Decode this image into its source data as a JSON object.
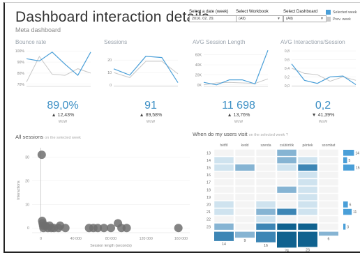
{
  "header": {
    "title": "Dashboard interaction details",
    "subtitle": "Meta dashboard"
  },
  "filters": {
    "date": {
      "label": "Select a date (week)",
      "value": "2016. 02. 29."
    },
    "workbook": {
      "label": "Select Workbook",
      "value": "(All)"
    },
    "dashboard": {
      "label": "Select Dashboard",
      "value": "(All)"
    }
  },
  "legend": [
    {
      "label": "Selected week",
      "color": "#4a9fd8"
    },
    {
      "label": "Prev. week",
      "color": "#c8c8c8"
    }
  ],
  "sparklines": [
    {
      "title": "Bounce rate",
      "yticks": [
        "100%",
        "90%",
        "80%",
        "70%"
      ],
      "ylim": [
        68,
        102
      ],
      "series": [
        {
          "name": "Selected week",
          "values": [
            93,
            91,
            99,
            88,
            78,
            99
          ]
        },
        {
          "name": "Prev. week",
          "values": [
            72,
            95,
            79,
            78,
            84,
            80
          ]
        }
      ]
    },
    {
      "title": "Sessions",
      "yticks": [
        "20",
        "10",
        "0"
      ],
      "ylim": [
        -1,
        29
      ],
      "series": [
        {
          "name": "Selected week",
          "values": [
            13,
            8,
            23,
            22,
            2
          ]
        },
        {
          "name": "Prev. week",
          "values": [
            10,
            6,
            19,
            19,
            9
          ]
        }
      ]
    },
    {
      "title": "AVG Session Length",
      "yticks": [
        "60K",
        "40K",
        "20K",
        "0K"
      ],
      "ylim": [
        -3000,
        72000
      ],
      "series": [
        {
          "name": "Selected week",
          "values": [
            5000,
            0,
            10000,
            10000,
            2000,
            69000
          ]
        },
        {
          "name": "Prev. week",
          "values": [
            0,
            4000,
            5000,
            4000,
            3000,
            12000
          ]
        }
      ]
    },
    {
      "title": "AVG Interactions/Session",
      "yticks": [
        "0,8",
        "0,6",
        "0,4",
        "0,2",
        "0,0"
      ],
      "ylim": [
        -0.02,
        0.85
      ],
      "series": [
        {
          "name": "Selected week",
          "values": [
            0.5,
            0.12,
            0.05,
            0.2,
            0.22,
            0.02
          ]
        },
        {
          "name": "Prev. week",
          "values": [
            0.4,
            0.28,
            0.25,
            0.1,
            0.2,
            0.12
          ]
        }
      ]
    }
  ],
  "kpis": [
    {
      "value": "89,0%",
      "arrow": "▲",
      "delta": "12,43%",
      "wow": "WoW"
    },
    {
      "value": "91",
      "arrow": "▲",
      "delta": "89,58%",
      "wow": "WoW"
    },
    {
      "value": "11 698",
      "arrow": "▲",
      "delta": "13,76%",
      "wow": "WoW"
    },
    {
      "value": "0,2",
      "arrow": "▼",
      "delta": "41,39%",
      "wow": "WoW"
    }
  ],
  "sessions_section": {
    "title": "All sessions",
    "title_suffix": "on the selected week"
  },
  "heatmap_section": {
    "title": "When do my users visit",
    "title_suffix": "on the selected week ?"
  },
  "chart_data": [
    {
      "type": "scatter",
      "title": "All sessions on the selected week",
      "xlabel": "Session length (seconds)",
      "ylabel": "Interactions",
      "xlim": [
        -10000,
        170000
      ],
      "ylim": [
        -2,
        34
      ],
      "xticks": [
        "0",
        "40 000",
        "80 000",
        "120 000",
        "160 000"
      ],
      "xtick_values": [
        0,
        40000,
        80000,
        120000,
        160000
      ],
      "yticks": [
        "30",
        "20",
        "10",
        "0"
      ],
      "ytick_values": [
        30,
        20,
        10,
        0
      ],
      "points": [
        {
          "x": 1000,
          "y": 31
        },
        {
          "x": 1500,
          "y": 3
        },
        {
          "x": 2000,
          "y": 2
        },
        {
          "x": 2500,
          "y": 1
        },
        {
          "x": 3000,
          "y": 0
        },
        {
          "x": 5000,
          "y": 1
        },
        {
          "x": 8000,
          "y": 0
        },
        {
          "x": 10000,
          "y": 1
        },
        {
          "x": 12000,
          "y": 0
        },
        {
          "x": 15000,
          "y": 0
        },
        {
          "x": 20000,
          "y": 0
        },
        {
          "x": 22000,
          "y": 1
        },
        {
          "x": 28000,
          "y": 0
        },
        {
          "x": 55000,
          "y": 0
        },
        {
          "x": 60000,
          "y": 0
        },
        {
          "x": 65000,
          "y": 0
        },
        {
          "x": 72000,
          "y": 0
        },
        {
          "x": 80000,
          "y": 0
        },
        {
          "x": 88000,
          "y": 2
        },
        {
          "x": 92000,
          "y": 0
        },
        {
          "x": 98000,
          "y": 0
        },
        {
          "x": 157000,
          "y": 0
        }
      ]
    },
    {
      "type": "heatmap",
      "title": "When do my users visit on the selected week ?",
      "columns": [
        "hétfő",
        "kedd",
        "szerda",
        "csütörtök",
        "péntek",
        "szombat"
      ],
      "rows": [
        "13",
        "14",
        "15",
        "16",
        "17",
        "18",
        "19",
        "20",
        "21",
        "22",
        "23"
      ],
      "values": [
        [
          0,
          0,
          0,
          2,
          0,
          0
        ],
        [
          1,
          0,
          0,
          2,
          1,
          0
        ],
        [
          1,
          2,
          0,
          1,
          3,
          0
        ],
        [
          0,
          0,
          0,
          0,
          1,
          0
        ],
        [
          0,
          0,
          0,
          0,
          1,
          0
        ],
        [
          0,
          0,
          0,
          2,
          1,
          0
        ],
        [
          0,
          0,
          0,
          0,
          1,
          0
        ],
        [
          1,
          0,
          1,
          0,
          1,
          0
        ],
        [
          1,
          0,
          2,
          3,
          1,
          0
        ],
        [
          0,
          0,
          1,
          0,
          0,
          0
        ],
        [
          2,
          0,
          3,
          4,
          4,
          0
        ]
      ],
      "column_totals": [
        "14",
        "9",
        "16",
        "24",
        "23",
        "6"
      ],
      "row_totals": [
        "14",
        "5",
        "15",
        "",
        "",
        "",
        "",
        "6",
        "11",
        "",
        "3"
      ]
    }
  ]
}
